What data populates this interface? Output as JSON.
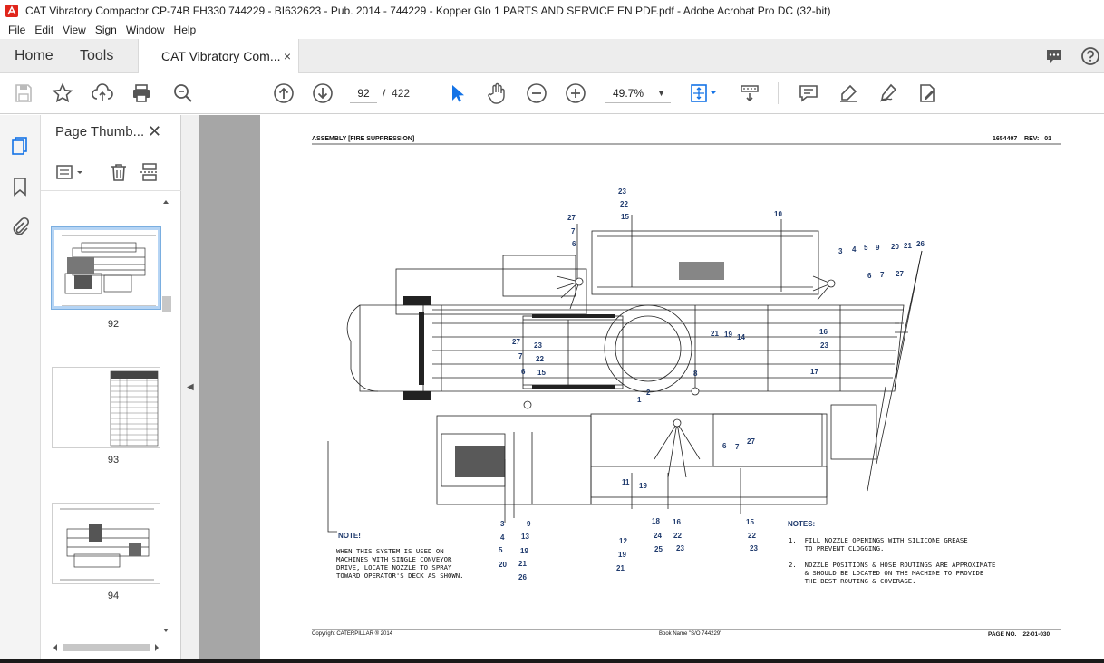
{
  "window": {
    "title": "CAT Vibratory Compactor CP-74B FH330 744229 - BI632623 - Pub. 2014 - 744229 - Kopper Glo 1 PARTS AND SERVICE EN PDF.pdf - Adobe Acrobat Pro DC (32-bit)"
  },
  "menu": [
    "File",
    "Edit",
    "View",
    "Sign",
    "Window",
    "Help"
  ],
  "tabs": {
    "home": "Home",
    "tools": "Tools",
    "document": "CAT Vibratory Com...",
    "close_symbol": "×"
  },
  "toolbar": {
    "current_page": "92",
    "page_separator": "/",
    "total_pages": "422",
    "zoom": "49.7%"
  },
  "thumbnails_panel": {
    "title": "Page Thumb...",
    "close_symbol": "✕",
    "pages": [
      {
        "label": "92",
        "selected": true
      },
      {
        "label": "93",
        "selected": false
      },
      {
        "label": "94",
        "selected": false
      }
    ]
  },
  "pdf_page": {
    "header_left": "ASSEMBLY [FIRE SUPPRESSION]",
    "header_right": "1654407    REV:   01",
    "footer_left": "Copyright CATERPILLAR ® 2014",
    "footer_mid": "Book Name \"S/O 744229\"",
    "footer_right": "PAGE NO.    22-01-030",
    "note_left_title": "NOTE!",
    "note_left_text": "WHEN THIS SYSTEM IS USED ON\nMACHINES WITH SINGLE CONVEYOR\nDRIVE, LOCATE NOZZLE TO SPRAY\nTOWARD OPERATOR'S DECK AS SHOWN.",
    "notes_title": "NOTES:",
    "notes_1": "1.  FILL NOZZLE OPENINGS WITH SILICONE GREASE\n    TO PREVENT CLOGGING.",
    "notes_2": "2.  NOZZLE POSITIONS & HOSE ROUTINGS ARE APPROXIMATE\n    & SHOULD BE LOCATED ON THE MACHINE TO PROVIDE\n    THE BEST ROUTING & COVERAGE.",
    "callouts": [
      "23",
      "22",
      "15",
      "27",
      "7",
      "6",
      "10",
      "3",
      "4",
      "5",
      "9",
      "20",
      "21",
      "26",
      "6",
      "7",
      "27",
      "21",
      "19",
      "14",
      "16",
      "23",
      "27",
      "23",
      "7",
      "22",
      "6",
      "15",
      "8",
      "17",
      "2",
      "1",
      "6",
      "7",
      "27",
      "11",
      "19",
      "3",
      "4",
      "5",
      "20",
      "9",
      "13",
      "19",
      "21",
      "26",
      "12",
      "19",
      "21",
      "18",
      "24",
      "25",
      "16",
      "22",
      "23",
      "15",
      "22",
      "23"
    ]
  },
  "colors": {
    "accent_blue": "#1473e6",
    "callout_blue": "#1f3a6d",
    "doc_background": "#a6a6a6",
    "tab_bar": "#ededed"
  },
  "icons": [
    "save-icon",
    "star-icon",
    "upload-icon",
    "print-icon",
    "zoom-search-icon",
    "page-up-icon",
    "page-down-icon",
    "select-arrow-icon",
    "hand-icon",
    "zoom-out-icon",
    "zoom-in-icon",
    "fit-page-icon",
    "scroll-mode-icon",
    "comment-icon",
    "highlight-icon",
    "sign-icon",
    "edit-pdf-icon",
    "help-icon",
    "chat-icon"
  ]
}
